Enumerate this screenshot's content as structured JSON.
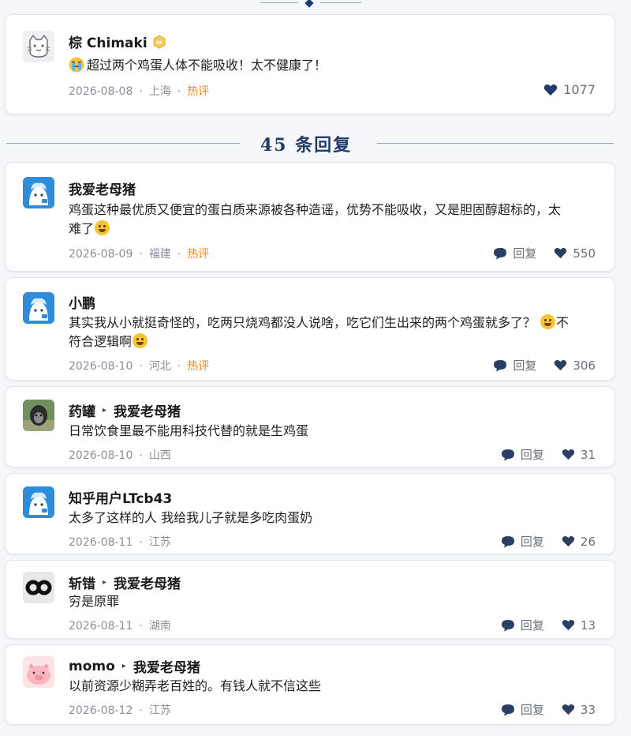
{
  "section_title": "45 条回复",
  "main_comment": {
    "name": "棕 Chimaki",
    "content": "超过两个鸡蛋人体不能吸收！太不健康了！",
    "date": "2026-08-08",
    "location": "上海",
    "hot": "热评",
    "likes": "1077",
    "icons": [
      "cat-avatar",
      "badge-icon",
      "crying-face-emoji",
      "heart-icon"
    ]
  },
  "replies": [
    {
      "name": "我爱老母猪",
      "content_a": "鸡蛋这种最优质又便宜的蛋白质来源被各种造谣，优势不能吸收，又是胆固醇超标的，太",
      "content_b": "难了",
      "date": "2026-08-09",
      "location": "福建",
      "hot": "热评",
      "reply_label": "回复",
      "likes": "550"
    },
    {
      "name": "小鹏",
      "content_a": "其实我从小就挺奇怪的，吃两只烧鸡都没人说啥，吃它们生出来的两个鸡蛋就多了？",
      "content_b": "不",
      "content_c": "符合逻辑啊",
      "date": "2026-08-10",
      "location": "河北",
      "hot": "热评",
      "reply_label": "回复",
      "likes": "306"
    },
    {
      "name": "药罐",
      "reply_to": "我爱老母猪",
      "content": "日常饮食里最不能用科技代替的就是生鸡蛋",
      "date": "2026-08-10",
      "location": "山西",
      "reply_label": "回复",
      "likes": "31"
    },
    {
      "name": "知乎用户LTcb43",
      "content": "太多了这样的人 我给我儿子就是多吃肉蛋奶",
      "date": "2026-08-11",
      "location": "江苏",
      "reply_label": "回复",
      "likes": "26"
    },
    {
      "name": "斩错",
      "reply_to": "我爱老母猪",
      "content": "穷是原罪",
      "date": "2026-08-11",
      "location": "湖南",
      "reply_label": "回复",
      "likes": "13"
    },
    {
      "name": "momo",
      "reply_to": "我爱老母猪",
      "content": "以前资源少糊弄老百姓的。有钱人就不信这些",
      "date": "2026-08-12",
      "location": "江苏",
      "reply_label": "回复",
      "likes": "33"
    }
  ],
  "colors": {
    "hot": "#f08a17",
    "title": "#203b6c",
    "muted": "#8a8f99"
  }
}
